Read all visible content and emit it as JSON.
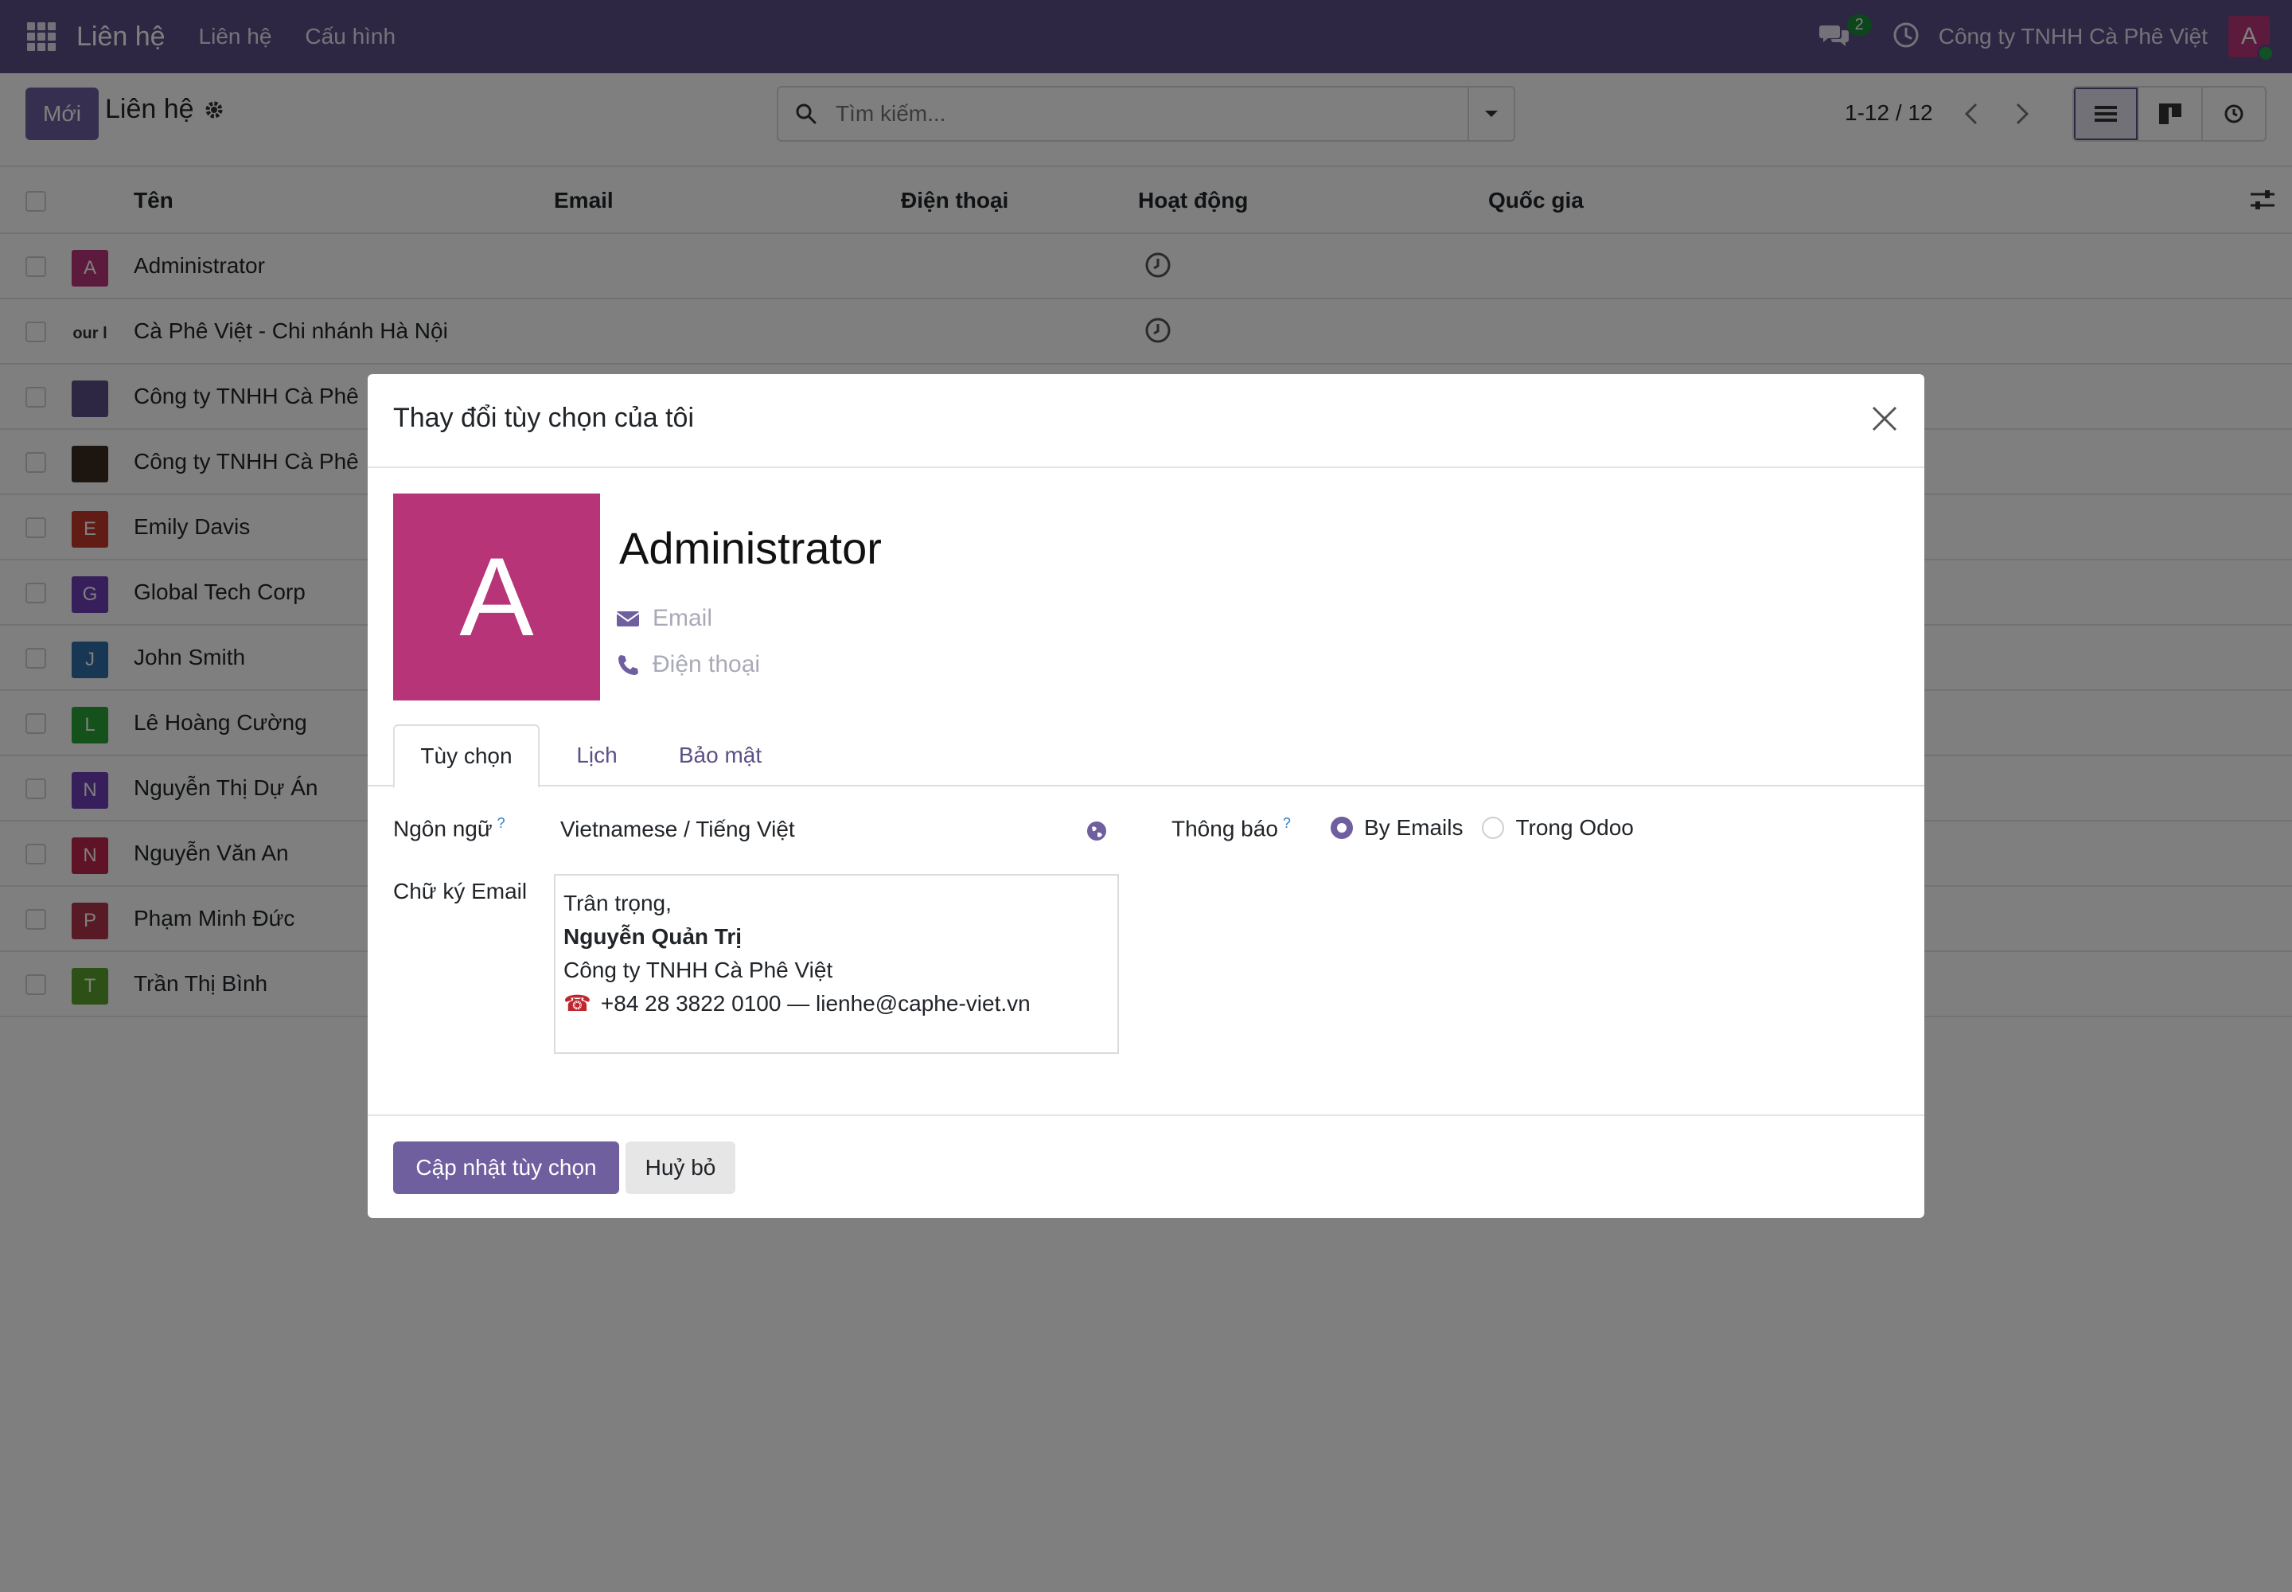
{
  "navbar": {
    "app_name": "Liên hệ",
    "menu": [
      "Liên hệ",
      "Cấu hình"
    ],
    "chat_badge": "2",
    "company": "Công ty TNHH Cà Phê Việt",
    "user_initial": "A",
    "brand_color": "#5c4f86"
  },
  "control": {
    "new_label": "Mới",
    "breadcrumb": "Liên hệ",
    "search_placeholder": "Tìm kiếm...",
    "pager": "1-12 / 12"
  },
  "list": {
    "columns": [
      "Tên",
      "Email",
      "Điện thoại",
      "Hoạt động",
      "Quốc gia"
    ],
    "rows": [
      {
        "initial": "A",
        "name": "Administrator",
        "color": "#b83478"
      },
      {
        "initial": "our l",
        "name": "Cà Phê Việt - Chi nhánh Hà Nội",
        "color": "#ffffff"
      },
      {
        "initial": "",
        "name": "Công ty TNHH Cà Phê",
        "color": "#5c4f86"
      },
      {
        "initial": "",
        "name": "Công ty TNHH Cà Phê",
        "color": "#3a2a1e"
      },
      {
        "initial": "E",
        "name": "Emily Davis",
        "color": "#c0392b"
      },
      {
        "initial": "G",
        "name": "Global Tech Corp",
        "color": "#6c3fb5"
      },
      {
        "initial": "J",
        "name": "John Smith",
        "color": "#2e6fa8"
      },
      {
        "initial": "L",
        "name": "Lê Hoàng Cường",
        "color": "#2aa334"
      },
      {
        "initial": "N",
        "name": "Nguyễn Thị Dự Án",
        "color": "#6c3fb5"
      },
      {
        "initial": "N",
        "name": "Nguyễn Văn An",
        "color": "#c0244f"
      },
      {
        "initial": "P",
        "name": "Phạm Minh Đức",
        "color": "#b0344a"
      },
      {
        "initial": "T",
        "name": "Trần Thị Bình",
        "color": "#5aa02c"
      }
    ]
  },
  "modal": {
    "title": "Thay đổi tùy chọn của tôi",
    "avatar_initial": "A",
    "name": "Administrator",
    "email_placeholder": "Email",
    "phone_placeholder": "Điện thoại",
    "tabs": [
      "Tùy chọn",
      "Lịch",
      "Bảo mật"
    ],
    "language_label": "Ngôn ngữ",
    "language_value": "Vietnamese / Tiếng Việt",
    "notification_label": "Thông báo",
    "notification_options": [
      "By Emails",
      "Trong Odoo"
    ],
    "signature_label": "Chữ ký Email",
    "signature": {
      "line1": "Trân trọng,",
      "line2": "Nguyễn Quản Trị",
      "line3": "Công ty TNHH Cà Phê Việt",
      "line4": "+84 28 3822 0100 — lienhe@caphe-viet.vn"
    },
    "help_mark": "?",
    "update_button": "Cập nhật tùy chọn",
    "cancel_button": "Huỷ bỏ"
  }
}
